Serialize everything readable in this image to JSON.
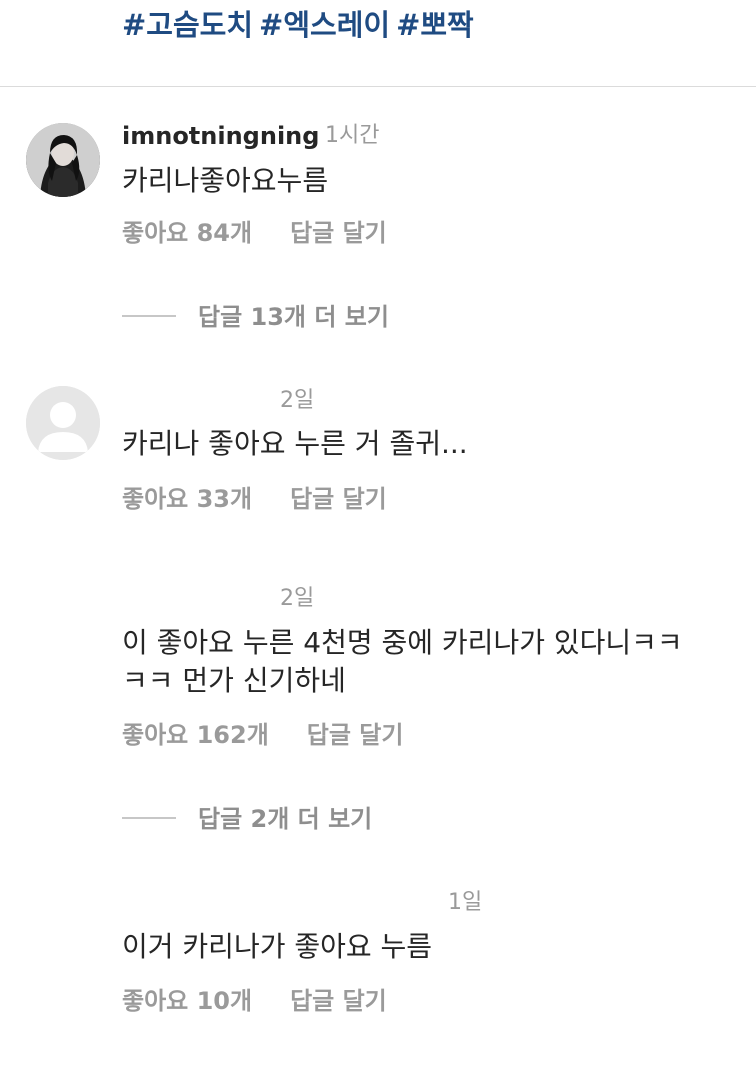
{
  "hashtags": [
    "#고슴도치",
    "#엑스레이",
    "#뽀짝"
  ],
  "comments": [
    {
      "username": "imnotningning",
      "time": "1시간",
      "text_lines": [
        "카리나좋아요누름"
      ],
      "likes": "좋아요 84개",
      "reply": "답글 달기",
      "more_replies": "답글 13개 더 보기"
    },
    {
      "username": "",
      "time": "2일",
      "text_lines": [
        "카리나 좋아요 누른 거 졸귀..."
      ],
      "likes": "좋아요 33개",
      "reply": "답글 달기"
    },
    {
      "username": "",
      "time": "2일",
      "text_lines": [
        "이 좋아요 누른 4천명 중에 카리나가 있다니ㅋㅋ",
        "ㅋㅋ 먼가 신기하네"
      ],
      "likes": "좋아요 162개",
      "reply": "답글 달기",
      "more_replies": "답글 2개 더 보기"
    },
    {
      "username": "",
      "time": "1일",
      "text_lines": [
        "이거 카리나가 좋아요 누름"
      ],
      "likes": "좋아요 10개",
      "reply": "답글 달기"
    }
  ],
  "colors": {
    "hashtag": "#1f4b82",
    "muted": "#9a9a9a",
    "text": "#262626",
    "divider": "#dbdbdb"
  }
}
